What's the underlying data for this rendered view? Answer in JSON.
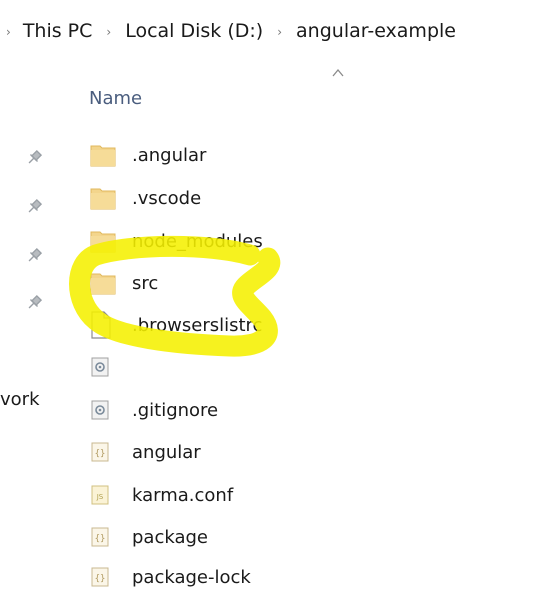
{
  "breadcrumb": {
    "items": [
      "This PC",
      "Local Disk (D:)",
      "angular-example"
    ]
  },
  "column_header": {
    "name_label": "Name",
    "sort": "ascending"
  },
  "nav_pane": {
    "partial_label": "vork",
    "pinned_count": 4
  },
  "files": [
    {
      "name": ".angular",
      "type": "folder"
    },
    {
      "name": ".vscode",
      "type": "folder"
    },
    {
      "name": "node_modules",
      "type": "folder"
    },
    {
      "name": "src",
      "type": "folder"
    },
    {
      "name": ".browserslistrc",
      "type": "file"
    },
    {
      "name": "",
      "type": "config"
    },
    {
      "name": ".gitignore",
      "type": "config"
    },
    {
      "name": "angular",
      "type": "json"
    },
    {
      "name": "karma.conf",
      "type": "js"
    },
    {
      "name": "package",
      "type": "json"
    },
    {
      "name": "package-lock",
      "type": "json"
    }
  ],
  "annotation": {
    "highlight_color": "#f5f000",
    "encircles": [
      "src",
      ".browserslistrc"
    ]
  },
  "colors": {
    "folder": "#f3d58c",
    "header_text": "#4a5d7e"
  }
}
